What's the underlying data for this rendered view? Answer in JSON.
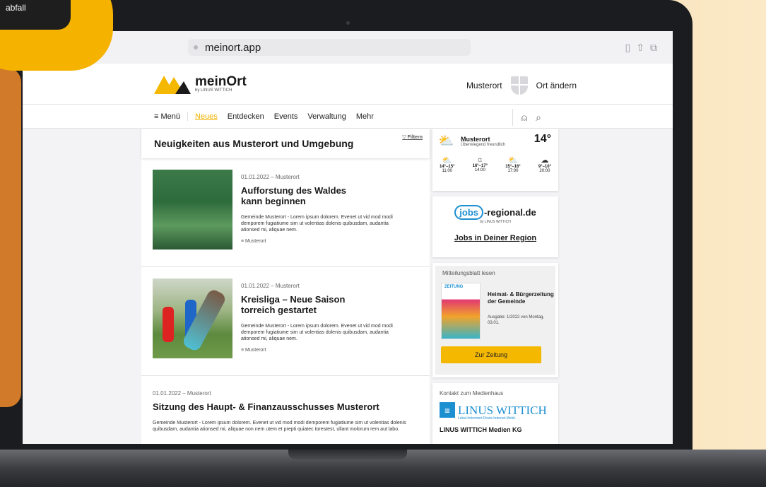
{
  "watch": {
    "label": "abfall"
  },
  "browser": {
    "url": "meinort.app",
    "back": "‹",
    "forward": "›"
  },
  "header": {
    "logo_text": "meinOrt",
    "logo_sub": "by LINUS WITTICH",
    "location": "Musterort",
    "change_location": "Ort ändern"
  },
  "nav": {
    "menu": "≡ Menü",
    "items": [
      {
        "label": "Neues",
        "active": true
      },
      {
        "label": "Entdecken"
      },
      {
        "label": "Events"
      },
      {
        "label": "Verwaltung"
      },
      {
        "label": "Mehr"
      }
    ]
  },
  "main": {
    "title": "Neuigkeiten aus Musterort und Umgebung",
    "filter": "Filtern",
    "articles": [
      {
        "meta": "01.01.2022 – Musterort",
        "title": "Aufforstung des Waldes kann beginnen",
        "body": "Gemeinde Musterort - Lorem ipsum dolorem. Evenet ut vid mod modi demporem fugiatiume sim ut volentias dolenis quibusdam, audantia ationsed mi, aliquae nem.",
        "category": "Musterort"
      },
      {
        "meta": "01.01.2022 – Musterort",
        "title": "Kreisliga – Neue Saison torreich gestartet",
        "body": "Gemeinde Musterort - Lorem ipsum dolorem. Evenet ut vid mod modi demporem fugiatiume sim ut volentias dolenis quibusdam, audantia ationsed mi, aliquae nem.",
        "category": "Musterort"
      },
      {
        "meta": "01.01.2022 – Musterort",
        "title": "Sitzung des Haupt- & Finanzausschusses Musterort",
        "body": "Gemeinde Musterort - Lorem ipsum dolorem. Evenet ut vid mod modi demporem fugiatiume sim ut volentias dolenis quibusdam, audantia ationsed mi, aliquae non nem utem et prepti quiatec torestest, ullant molorum rem aut labo."
      }
    ]
  },
  "weather": {
    "location": "Musterort",
    "description": "Überwiegend freundlich",
    "temp": "14°",
    "forecast": [
      {
        "range": "14°–15°",
        "time": "11:00",
        "icon": "cloud-sun-icon"
      },
      {
        "range": "16°–17°",
        "time": "14:00",
        "icon": "sun-icon"
      },
      {
        "range": "15°–16°",
        "time": "17:00",
        "icon": "cloud-sun-icon"
      },
      {
        "range": "9°–10°",
        "time": "20:00",
        "icon": "cloud-icon"
      }
    ]
  },
  "jobs": {
    "logo_pill": "jobs",
    "logo_rest": "-regional.de",
    "logo_sub": "by LINUS WITTICH",
    "link": "Jobs in Deiner Region"
  },
  "paper": {
    "title": "Mitteilungsblatt lesen",
    "cover_label": "ZEITUNG",
    "headline": "Heimat- & Bürgerzeitung der Gemeinde",
    "issue": "Ausgabe: 1/2022 von Montag, 03.01.",
    "button": "Zur Zeitung"
  },
  "contact": {
    "title": "Kontakt zum Medienhaus",
    "logo_name": "LINUS WITTICH",
    "logo_tag": "Lokal.Informiert.Druck.Internet.Mobil.",
    "company": "LINUS WITTICH Medien KG"
  },
  "colors": {
    "accent": "#f2b200",
    "brand_blue": "#1c8fd1"
  }
}
